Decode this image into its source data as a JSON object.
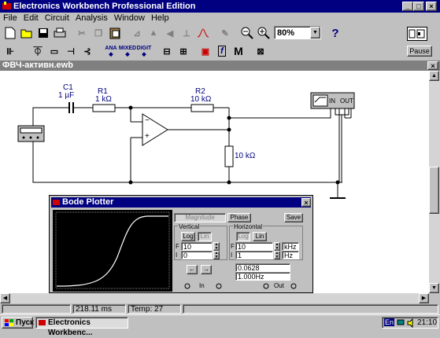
{
  "window": {
    "title": "Electronics Workbench Professional Edition",
    "min": "_",
    "max": "□",
    "close": "×"
  },
  "menu": [
    "File",
    "Edit",
    "Circuit",
    "Analysis",
    "Window",
    "Help"
  ],
  "toolbar": {
    "zoom_value": "80%",
    "help": "?",
    "pause": "Pause",
    "ana": "ANA",
    "mixed": "MIXED",
    "digit": "DIGIT",
    "m": "M",
    "f": "f"
  },
  "document": {
    "title": "ФВЧ-активн.ewb",
    "close": "×"
  },
  "circuit": {
    "c1_name": "C1",
    "c1_value": "1 µF",
    "r1_name": "R1",
    "r1_value": "1 kΩ",
    "r2_name": "R2",
    "r2_value": "10 kΩ",
    "r3_value": "10 kΩ",
    "bode_in": "IN",
    "bode_out": "OUT",
    "opamp_minus": "−",
    "opamp_plus": "+"
  },
  "bode": {
    "title": "Bode Plotter",
    "close": "×",
    "magnitude": "Magnitude",
    "phase": "Phase",
    "save": "Save",
    "vertical": "Vertical",
    "horizontal": "Horizontal",
    "log": "Log",
    "lin": "Lin",
    "v_f_label": "F",
    "v_f_value": "10",
    "v_f_unit": "",
    "v_i_label": "I",
    "v_i_value": "0",
    "v_i_unit": "",
    "h_f_label": "F",
    "h_f_value": "10",
    "h_f_unit": "kHz",
    "h_i_label": "I",
    "h_i_value": "1",
    "h_i_unit": "Hz",
    "readout_value": "0.0628",
    "readout_freq": "1.000Hz",
    "left_arrow": "←",
    "right_arrow": "→",
    "in": "In",
    "out": "Out"
  },
  "status": {
    "time": "218.11 ms",
    "temp": "Temp:  27"
  },
  "taskbar": {
    "start": "Пуск",
    "task": "Electronics Workbenc...",
    "lang": "En",
    "clock": "21:10"
  }
}
